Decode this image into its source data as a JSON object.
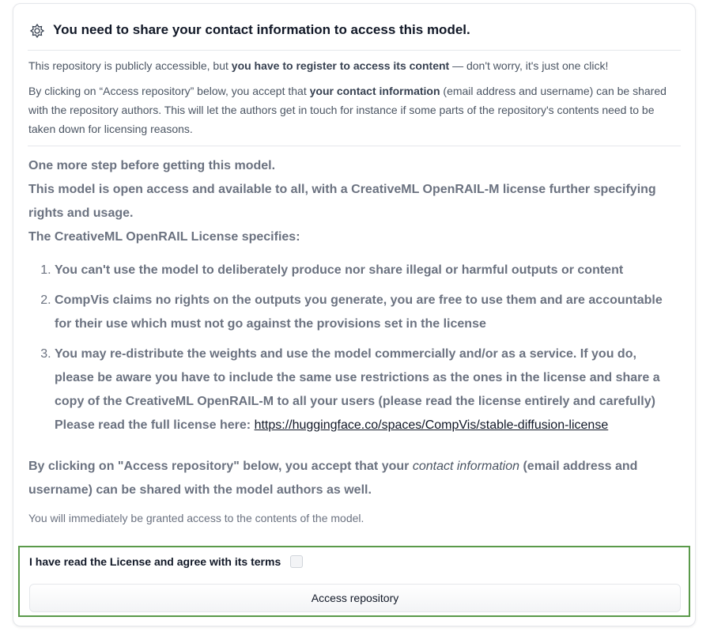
{
  "header": {
    "title": "You need to share your contact information to access this model.",
    "icon": "gated-icon"
  },
  "intro": {
    "p1_start": "This repository is publicly accessible, but ",
    "p1_bold": "you have to register to access its content",
    "p1_end": " — don't worry, it's just one click!",
    "p2_start": "By clicking on “Access repository” below, you accept that ",
    "p2_bold": "your contact information",
    "p2_end": " (email address and username) can be shared with the repository authors. This will let the authors get in touch for instance if some parts of the repository's contents need to be taken down for licensing reasons."
  },
  "gate": {
    "line1": "One more step before getting this model.",
    "line2": "This model is open access and available to all, with a CreativeML OpenRAIL-M license further specifying rights and usage.",
    "line3": "The CreativeML OpenRAIL License specifies:",
    "items": [
      "You can't use the model to deliberately produce nor share illegal or harmful outputs or content",
      "CompVis claims no rights on the outputs you generate, you are free to use them and are accountable for their use which must not go against the provisions set in the license",
      "You may re-distribute the weights and use the model commercially and/or as a service. If you do, please be aware you have to include the same use restrictions as the ones in the license and share a copy of the CreativeML OpenRAIL-M to all your users (please read the license entirely and carefully)"
    ],
    "read_full": "Please read the full license here: ",
    "license_link": "https://huggingface.co/spaces/CompVis/stable-diffusion-license"
  },
  "consent": {
    "start": "By clicking on \"Access repository\" below, you accept that your ",
    "em": "contact information",
    "end": " (email address and username) can be shared with the model authors as well."
  },
  "granted": "You will immediately be granted access to the contents of the model.",
  "form": {
    "agree_label": "I have read the License and agree with its terms",
    "agree_checked": false,
    "button_label": "Access repository"
  },
  "colors": {
    "highlight_border": "#5a9a4a"
  }
}
